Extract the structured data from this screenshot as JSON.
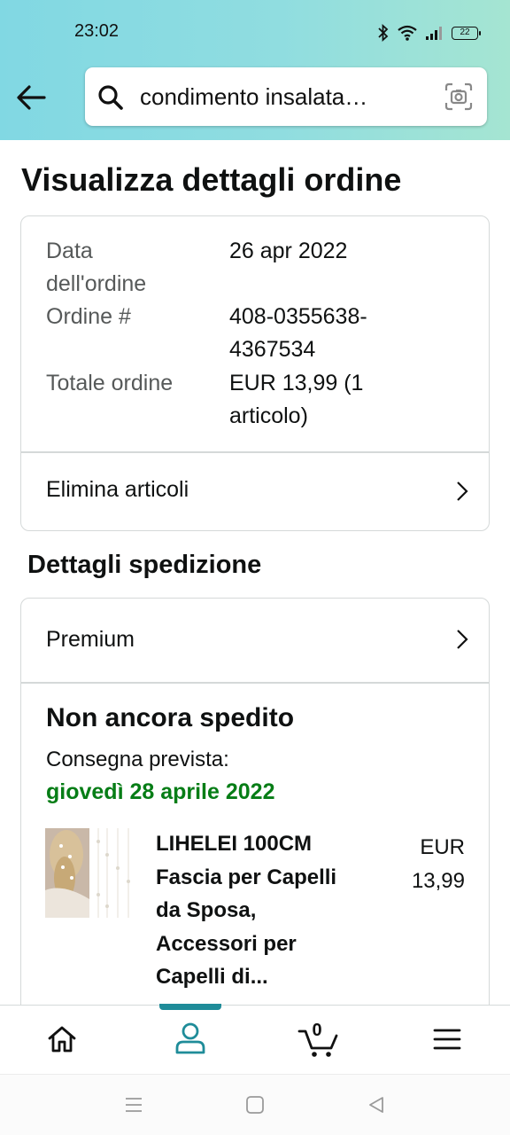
{
  "status_bar": {
    "time": "23:02",
    "battery": "22"
  },
  "search": {
    "query": "condimento insalata…"
  },
  "page": {
    "title": "Visualizza dettagli ordine"
  },
  "order_info": {
    "date_label_1": "Data",
    "date_label_2": "dell'ordine",
    "date_value": "26 apr 2022",
    "number_label": "Ordine #",
    "number_value_1": "408-0355638-",
    "number_value_2": "4367534",
    "total_label": "Totale ordine",
    "total_value_1": "EUR 13,99 (1",
    "total_value_2": "articolo)",
    "delete_items": "Elimina articoli"
  },
  "shipping": {
    "section_title": "Dettagli spedizione",
    "method": "Premium",
    "status": "Non ancora spedito",
    "delivery_label": "Consegna prevista:",
    "delivery_date": "giovedì 28 aprile 2022",
    "delivery_date_color": "#067d16"
  },
  "product": {
    "title_lines": [
      "LIHELEI 100CM",
      "Fascia per Capelli",
      "da Sposa,",
      "Accessori per",
      "Capelli di..."
    ],
    "price_line_1": "EUR",
    "price_line_2": "13,99"
  },
  "bottom_nav": {
    "items": [
      "home-icon",
      "account-icon",
      "cart-icon",
      "menu-icon"
    ],
    "active": "account",
    "cart_count": "0",
    "accent_color": "#1f8c99"
  }
}
